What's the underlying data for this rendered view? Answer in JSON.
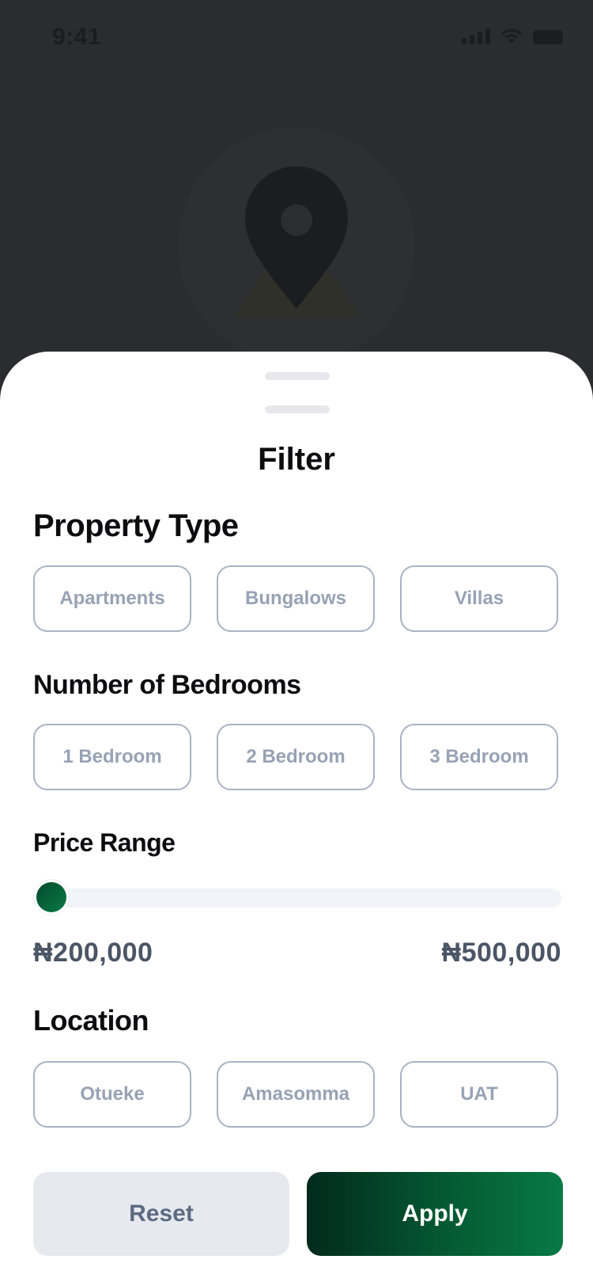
{
  "status_bar": {
    "time": "9:41",
    "icons": [
      "signal-icon",
      "wifi-icon",
      "battery-icon"
    ]
  },
  "background": {
    "illustration": "map-pin-icon"
  },
  "sheet": {
    "title": "Filter",
    "property_type": {
      "title": "Property Type",
      "options": [
        "Apartments",
        "Bungalows",
        "Villas"
      ]
    },
    "bedrooms": {
      "title": "Number of Bedrooms",
      "options": [
        "1 Bedroom",
        "2 Bedroom",
        "3 Bedroom"
      ]
    },
    "price_range": {
      "title": "Price Range",
      "min_label": "₦200,000",
      "max_label": "₦500,000",
      "slider_position": 0
    },
    "location": {
      "title": "Location",
      "options": [
        "Otueke",
        "Amasomma",
        "UAT"
      ]
    },
    "buttons": {
      "reset_label": "Reset",
      "apply_label": "Apply"
    }
  },
  "colors": {
    "accent": "#077a45",
    "accent_dark": "#022a1c",
    "chip_border": "#a9b3c3",
    "chip_text": "#97a2b4",
    "overlay": "#2b2c2f"
  }
}
